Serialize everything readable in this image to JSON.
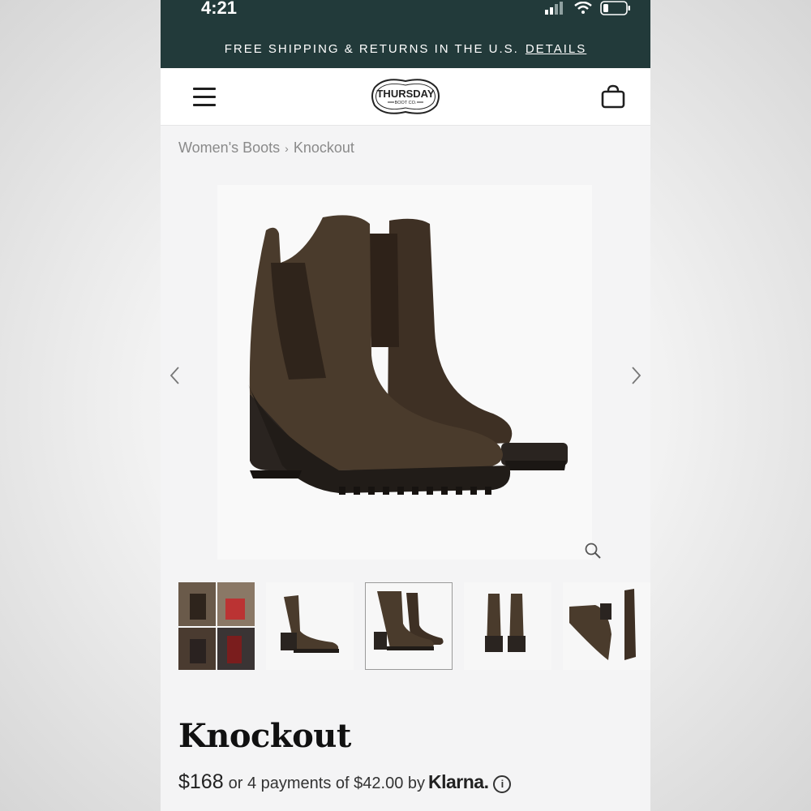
{
  "status_bar": {
    "time": "4:21"
  },
  "promo": {
    "text": "FREE SHIPPING & RETURNS IN THE U.S.",
    "link": "DETAILS"
  },
  "header": {
    "logo_line1": "THURSDAY",
    "logo_line2": "BOOT CO.",
    "menu_icon": "menu-icon",
    "bag_icon": "shopping-bag-icon"
  },
  "breadcrumb": {
    "parent": "Women's Boots",
    "current": "Knockout"
  },
  "gallery": {
    "main_image": "brown suede chelsea boots pair",
    "thumbnails": [
      "lifestyle collage",
      "single boot side view",
      "pair angled view",
      "pair front view",
      "boot heel detail"
    ],
    "selected_index": 2
  },
  "product": {
    "title": "Knockout",
    "price": "$168",
    "installments": "or 4 payments of $42.00 by",
    "klarna": "Klarna."
  },
  "colors": {
    "topband": "#223a3a",
    "boot": "#4a3b2c"
  }
}
